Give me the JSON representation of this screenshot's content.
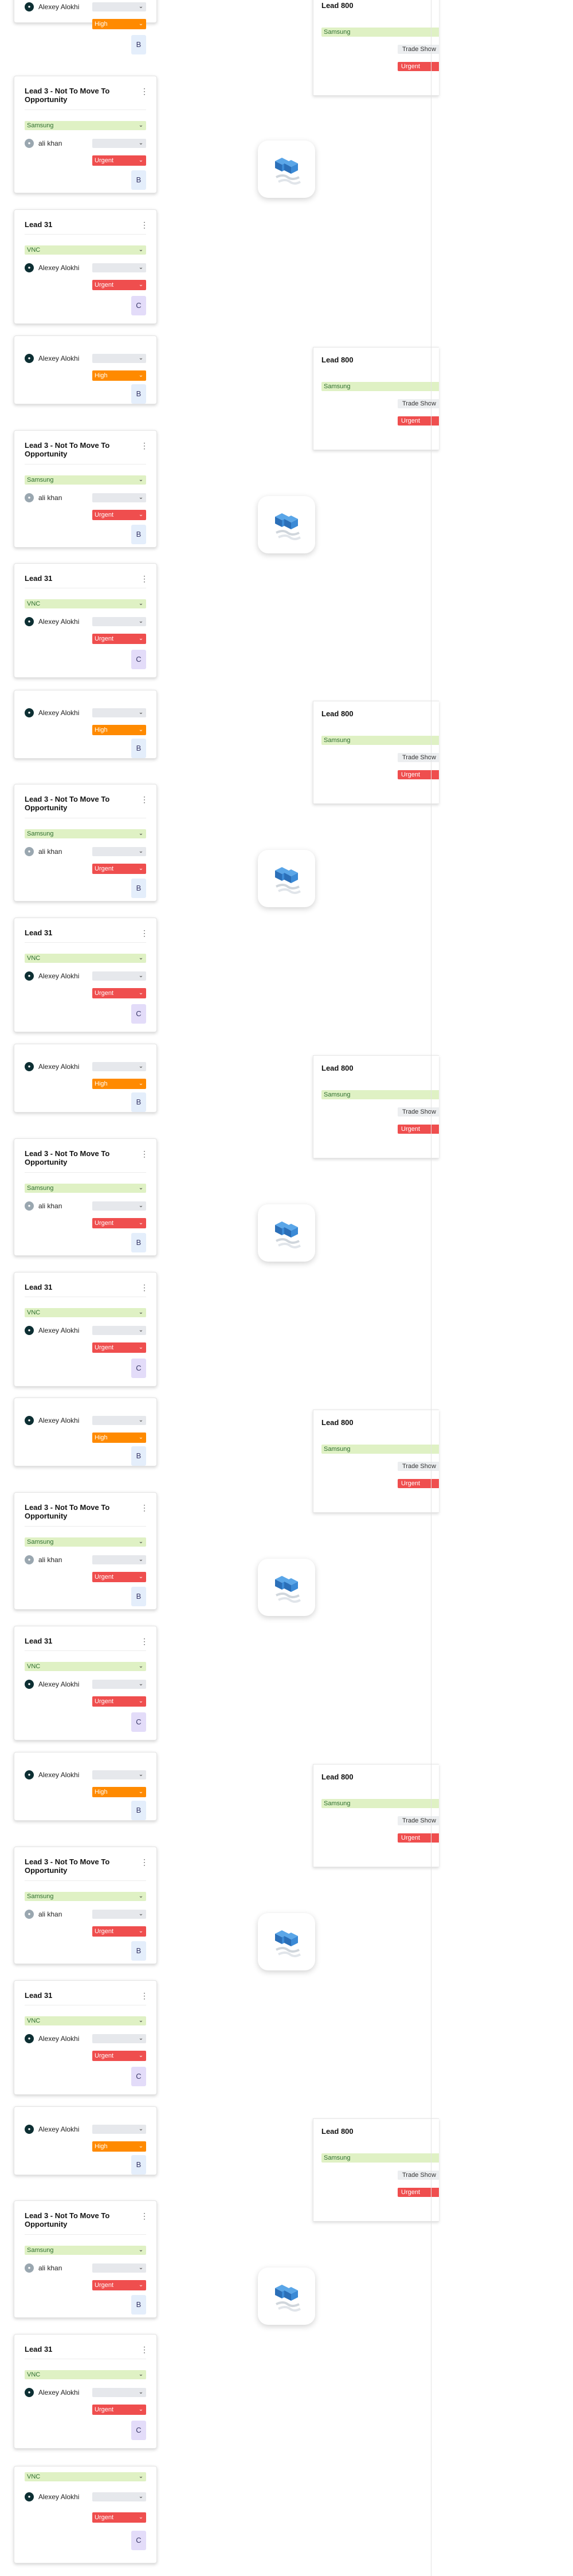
{
  "lead_c": {
    "title": "",
    "user": "Alexey Alokhi",
    "priority": "High",
    "tile": "B"
  },
  "lead_3": {
    "title": "Lead 3 - Not To Move To Opportunity",
    "company": "Samsung",
    "user": "ali khan",
    "priority": "Urgent",
    "tile": "B"
  },
  "lead_31": {
    "title": "Lead 31",
    "company": "VNC",
    "user": "Alexey Alokhi",
    "priority": "Urgent",
    "tile": "C"
  },
  "lead_800": {
    "title": "Lead 800",
    "company": "Samsung",
    "source": "Trade Show",
    "priority": "Urgent"
  },
  "partial_card": {
    "company": "VNC",
    "user": "Alexey Alokhi",
    "priority": "Urgent",
    "tile": "C"
  },
  "icons": {
    "menu": "kebab-menu-icon",
    "chevron": "chevron-down-icon",
    "logo": "stacked-blocks-logo"
  },
  "colors": {
    "company_pill": "#dff1c4",
    "high": "#ff8a00",
    "urgent": "#ef4e4e",
    "avatar": "#0d2f33",
    "logo_blue": "#2f7fcf"
  }
}
